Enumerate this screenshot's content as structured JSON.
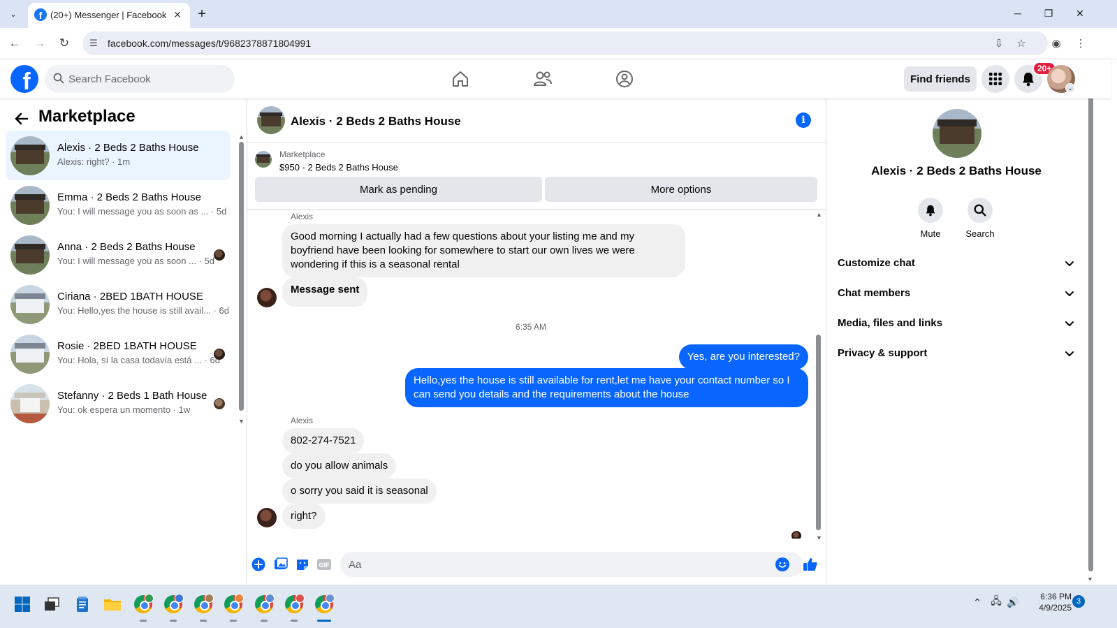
{
  "browser": {
    "tab_title": "(20+) Messenger | Facebook",
    "tab_favicon": "f",
    "url": "facebook.com/messages/t/9682378871804991"
  },
  "header": {
    "search_placeholder": "Search Facebook",
    "find_friends_label": "Find friends",
    "notifications_badge": "20+",
    "brand_color": "#0866ff"
  },
  "sidebar": {
    "title": "Marketplace",
    "chats": [
      {
        "name": "Alexis · 2 Beds 2 Baths House",
        "preview": "Alexis: right? · 1m",
        "active": true,
        "thumb": "house"
      },
      {
        "name": "Emma · 2 Beds 2 Baths House",
        "preview": "You: I will message you as soon as ... · 5d",
        "active": false,
        "thumb": "house"
      },
      {
        "name": "Anna · 2 Beds 2 Baths House",
        "preview": "You: I will message you as soon ... · 5d",
        "active": false,
        "thumb": "house"
      },
      {
        "name": "Ciriana · 2BED 1BATH HOUSE",
        "preview": "You: Hello,yes the house is still avail... · 6d",
        "active": false,
        "thumb": "white-house"
      },
      {
        "name": "Rosie · 2BED 1BATH HOUSE",
        "preview": "You: Hola, sí la casa todavía está ... · 6d",
        "active": false,
        "thumb": "white-house"
      },
      {
        "name": "Stefanny · 2 Beds 1 Bath House",
        "preview": "You: ok espera un momento · 1w",
        "active": false,
        "thumb": "white-house-red-steps"
      }
    ]
  },
  "conversation": {
    "title": "Alexis · 2 Beds 2 Baths House",
    "listing": {
      "source": "Marketplace",
      "price_title": "$950 - 2 Beds 2 Baths House",
      "mark_pending_label": "Mark as pending",
      "more_options_label": "More options"
    },
    "messages": {
      "sender_1": "Alexis",
      "m1": "Good morning I actually had a few questions about your listing me and my boyfriend have been looking for somewhere to start our own lives we were wondering if this is a seasonal rental",
      "m2": "Message sent",
      "time": "6:35 AM",
      "m3": "Yes, are you interested?",
      "m4": "Hello,yes the house is still available for rent,let me have your contact number   so I can send you details and the requirements about the house",
      "sender_2": "Alexis",
      "m5": "802-274-7521",
      "m6": "do you allow animals",
      "m7": "o sorry you said it is seasonal",
      "m8": "right?"
    },
    "composer_placeholder": "Aa"
  },
  "info_panel": {
    "name": "Alexis · 2 Beds 2 Baths House",
    "actions": [
      {
        "label": "Mute",
        "icon": "bell-icon"
      },
      {
        "label": "Search",
        "icon": "search-icon"
      }
    ],
    "sections": [
      "Customize chat",
      "Chat members",
      "Media, files and links",
      "Privacy & support"
    ]
  },
  "taskbar": {
    "time": "6:36 PM",
    "date": "4/9/2025",
    "notification_count": "3"
  }
}
